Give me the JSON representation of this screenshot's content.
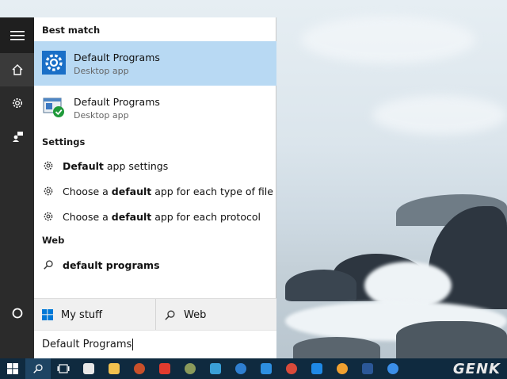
{
  "panel": {
    "best_match_heading": "Best match",
    "results": [
      {
        "title": "Default Programs",
        "subtitle": "Desktop app",
        "icon": "gear-app-icon"
      },
      {
        "title": "Default Programs",
        "subtitle": "Desktop app",
        "icon": "default-programs-checkmark-icon"
      }
    ],
    "settings_heading": "Settings",
    "settings": [
      {
        "bold": "Default",
        "rest": " app settings"
      },
      {
        "pre": "Choose a ",
        "bold": "default",
        "rest": " app for each type of file"
      },
      {
        "pre": "Choose a ",
        "bold": "default",
        "rest": " app for each protocol"
      }
    ],
    "web_heading": "Web",
    "web_suggestion": "default programs",
    "scope": {
      "my_stuff": "My stuff",
      "web": "Web"
    },
    "search_query": "Default Programs"
  },
  "taskbar": {
    "watermark": "GENK"
  },
  "colors": {
    "accent": "#0078d7",
    "selected_bg": "#b8d9f3",
    "rail_bg": "#2b2b2b",
    "taskbar_bg": "#0f2a3f"
  }
}
